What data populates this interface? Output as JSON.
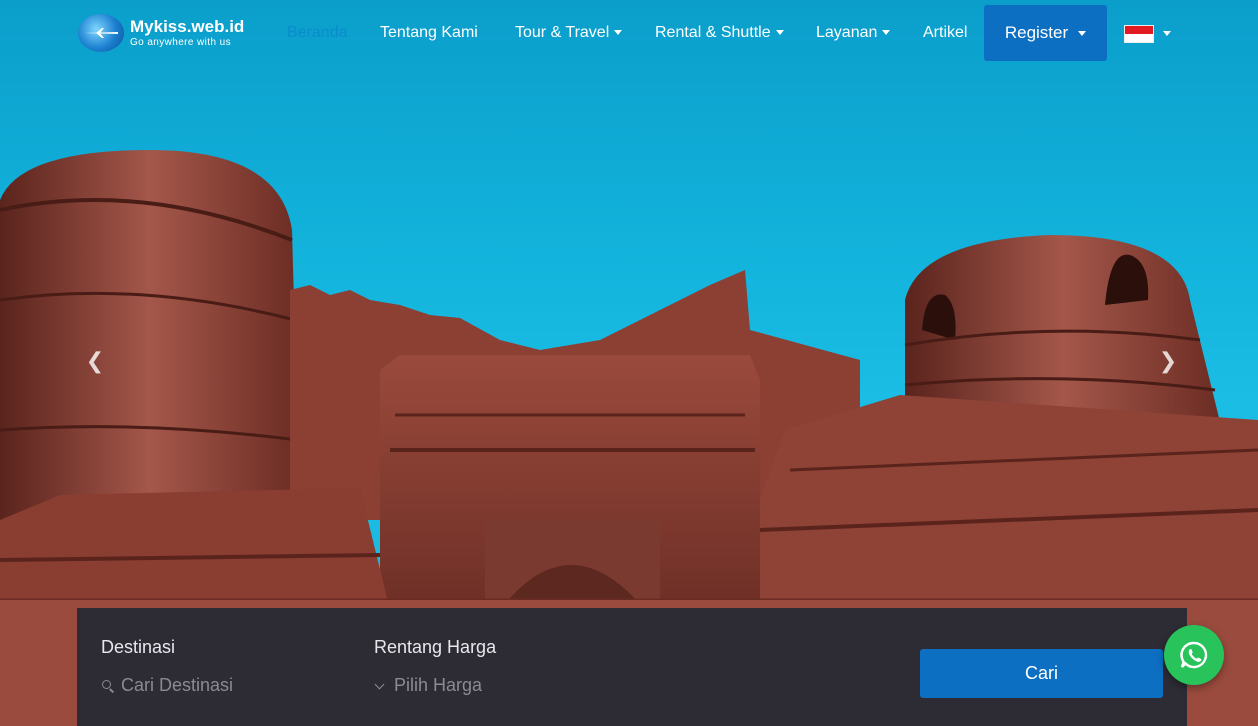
{
  "brand": {
    "name": "Mykiss.web.id",
    "tagline": "Go anywhere with us"
  },
  "nav": {
    "items": [
      {
        "label": "Beranda",
        "active": true
      },
      {
        "label": "Tentang Kami"
      },
      {
        "label": "Tour & Travel",
        "dropdown": true
      },
      {
        "label": "Rental & Shuttle",
        "dropdown": true
      },
      {
        "label": "Layanan",
        "dropdown": true
      },
      {
        "label": "Artikel"
      }
    ],
    "register_label": "Register",
    "language": "Indonesia flag"
  },
  "search": {
    "destination_label": "Destinasi",
    "destination_placeholder": "Cari Destinasi",
    "price_label": "Rentang Harga",
    "price_placeholder": "Pilih Harga",
    "submit_label": "Cari"
  },
  "colors": {
    "accent": "#0d6fc2",
    "panel": "#2d2b34",
    "whatsapp": "#28c35b"
  }
}
